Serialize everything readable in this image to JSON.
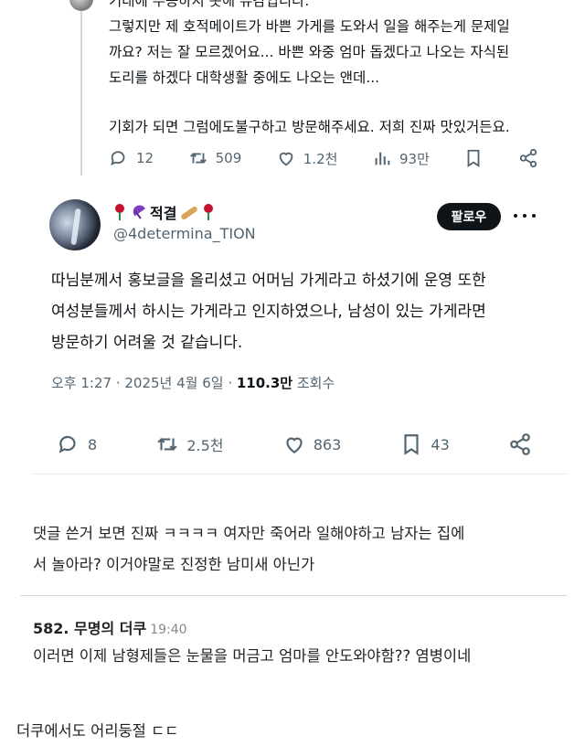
{
  "reply_tweet": {
    "text_lines": [
      "기대에 부응하지 못해 유감입니다.",
      "그렇지만 제 호적메이트가 바쁜 가게를 도와서 일을 해주는게 문제일",
      "까요? 저는 잘 모르겠어요... 바쁜 와중 엄마 돕겠다고 나오는 자식된",
      "도리를 하겠다 대학생활 중에도 나오는 앤데...",
      "기회가 되면 그럼에도불구하고 방문해주세요. 저희 진짜 맛있거든요."
    ],
    "stats": {
      "replies": "12",
      "retweets": "509",
      "likes": "1.2천",
      "views": "93만"
    }
  },
  "main_tweet": {
    "display_name": "적결",
    "handle": "@4determina_TION",
    "follow_label": "팔로우",
    "text_lines": [
      "따님분께서 홍보글을 올리셨고 어머님 가게라고 하셨기에 운영 또한",
      "여성분들께서 하시는 가게라고 인지하였으나, 남성이 있는 가게라면",
      "방문하기 어려울 것 같습니다."
    ],
    "timestamp": "오후 1:27 · 2025년 4월 6일 · ",
    "views_count": "110.3만",
    "views_label": " 조회수",
    "stats": {
      "replies": "8",
      "retweets": "2.5천",
      "likes": "863",
      "bookmarks": "43"
    }
  },
  "comment_1": {
    "lines": [
      "댓글 쓴거 보면 진짜 ㅋㅋㅋㅋ 여자만 죽어라 일해야하고 남자는 집에",
      "서 놀아라? 이거야말로 진정한 남미새 아닌가"
    ]
  },
  "comment_2": {
    "number_author": "582. 무명의 더쿠",
    "time": "19:40",
    "text": "이러면 이제 남형제들은 눈물을 머금고 엄마를 안도와야함?? 염병이네"
  },
  "caption": "더쿠에서도 어리둥절 ㄷㄷ",
  "colors": {
    "text": "#0f1419",
    "muted": "#536471",
    "follow_bg": "#0f1419"
  }
}
